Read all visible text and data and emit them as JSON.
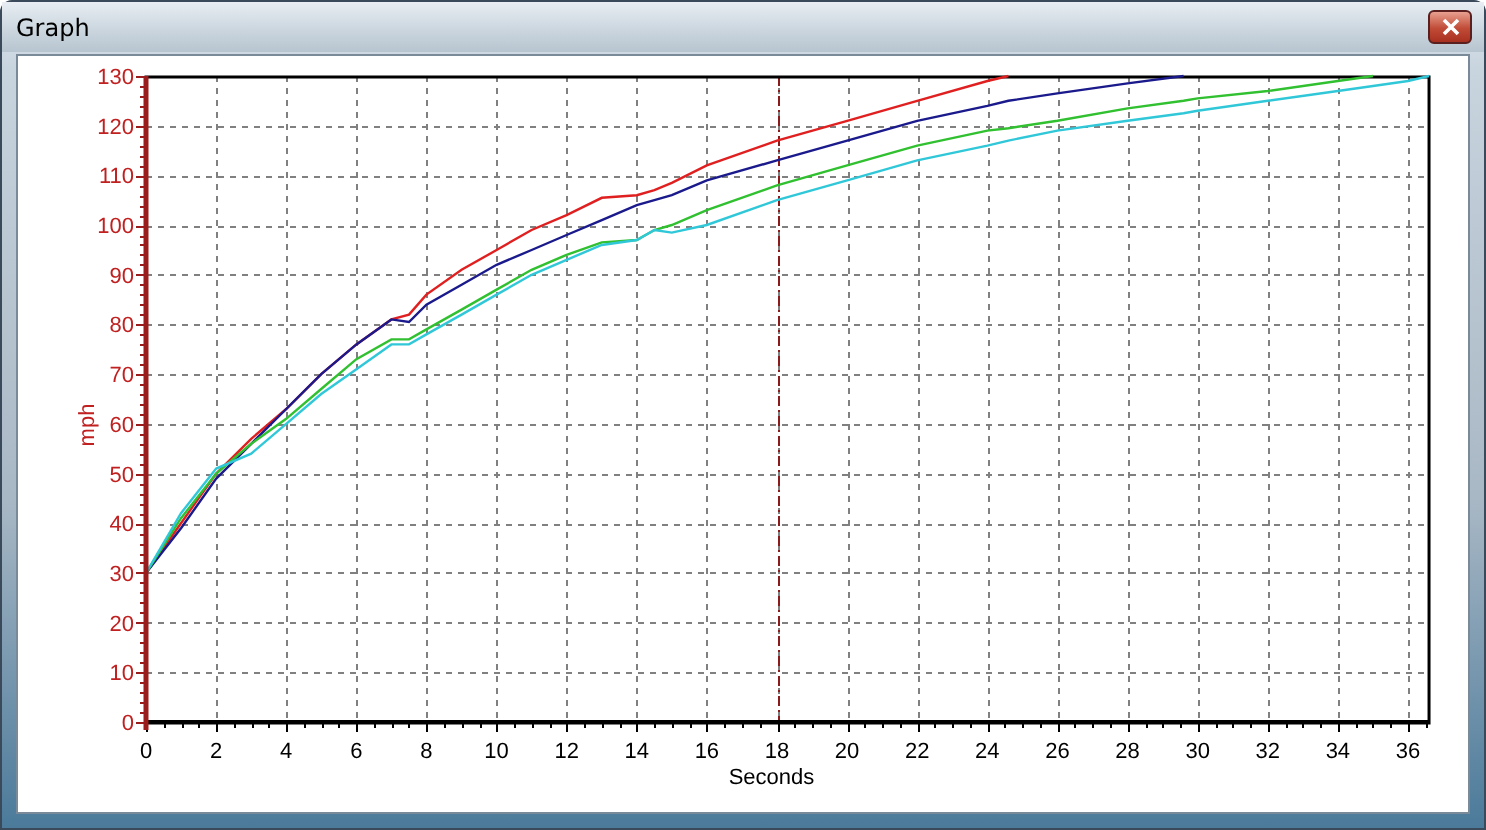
{
  "window": {
    "title": "Graph"
  },
  "chart_data": {
    "type": "line",
    "xlabel": "Seconds",
    "ylabel": "mph",
    "xlim": [
      0,
      36.6
    ],
    "ylim": [
      0,
      130
    ],
    "xticks": [
      0,
      2,
      4,
      6,
      8,
      10,
      12,
      14,
      16,
      18,
      20,
      22,
      24,
      26,
      28,
      30,
      32,
      34,
      36
    ],
    "yticks": [
      0,
      10,
      20,
      30,
      40,
      50,
      60,
      70,
      80,
      90,
      100,
      110,
      120,
      130
    ],
    "x": [
      0,
      1,
      2,
      3,
      4,
      5,
      6,
      7,
      7.5,
      8,
      9,
      10,
      11,
      12,
      13,
      14,
      14.5,
      15,
      16,
      18,
      20,
      22,
      24,
      24.6,
      26,
      28,
      29.6,
      30,
      32,
      34,
      35,
      36,
      36.6
    ],
    "series": [
      {
        "color": "#e02020",
        "values": [
          30,
          40,
          50,
          57,
          63,
          70,
          76,
          81,
          82,
          86,
          91,
          95,
          99,
          102,
          105.5,
          106,
          107,
          108.5,
          112,
          117,
          121,
          125,
          129,
          130,
          null,
          null,
          null,
          null,
          null,
          null,
          null,
          null,
          null
        ]
      },
      {
        "color": "#1a1a8c",
        "values": [
          30,
          39,
          49,
          56,
          63,
          70,
          76,
          81,
          80.5,
          84,
          88,
          92,
          95,
          98,
          101,
          104,
          105,
          106,
          109,
          113,
          117,
          121,
          124,
          125,
          126.5,
          128.5,
          130,
          null,
          null,
          null,
          null,
          null,
          null
        ]
      },
      {
        "color": "#30c030",
        "values": [
          30,
          41,
          50,
          56,
          61,
          67,
          73,
          77,
          77,
          79,
          83,
          87,
          91,
          94,
          96.5,
          97,
          99,
          100,
          103,
          108,
          112,
          116,
          119,
          119.5,
          121,
          123.5,
          125,
          125.5,
          127,
          129,
          130,
          null,
          null
        ]
      },
      {
        "color": "#30c8d8",
        "values": [
          30,
          42,
          51,
          54,
          60,
          66,
          71,
          76,
          76,
          78,
          82,
          86,
          90,
          93,
          96,
          97,
          99,
          98.5,
          100,
          105,
          109,
          113,
          116,
          117,
          119,
          121,
          122.5,
          123,
          125,
          127,
          128,
          129,
          130
        ]
      }
    ],
    "grid": true,
    "ref_lines": [
      {
        "axis": "x",
        "value": 18,
        "color": "#8b1a1a"
      }
    ]
  }
}
